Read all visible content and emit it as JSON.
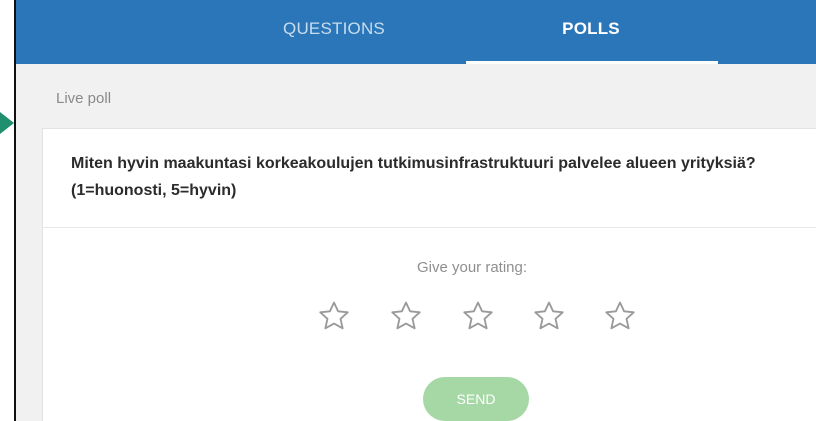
{
  "tabs": [
    {
      "label": "QUESTIONS",
      "active": false
    },
    {
      "label": "POLLS",
      "active": true
    }
  ],
  "section_label": "Live poll",
  "poll": {
    "question": "Miten hyvin maakuntasi korkeakoulujen tutkimusinfrastruktuuri palvelee alueen yrityksiä? (1=huonosti, 5=hyvin)",
    "rating_prompt": "Give your rating:",
    "rating_max": 5,
    "rating_value": 0,
    "send_label": "SEND"
  },
  "colors": {
    "tabbar": "#2a76b8",
    "send_button": "#a6d8a6",
    "pointer": "#1f8f6d",
    "star_outline": "#9a9a9a"
  },
  "icons": {
    "star": "star-outline-icon",
    "pointer": "pointer-arrow-icon"
  }
}
